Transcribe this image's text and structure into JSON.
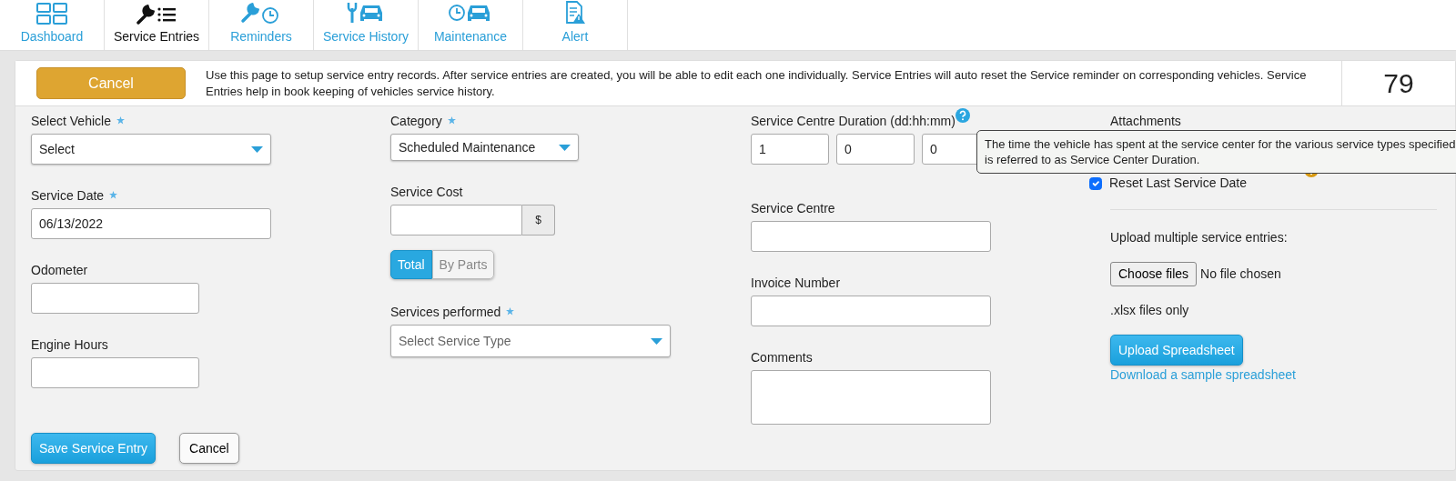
{
  "nav_tabs": [
    {
      "label": "Dashboard",
      "selected": false
    },
    {
      "label": "Service Entries",
      "selected": true
    },
    {
      "label": "Reminders",
      "selected": false
    },
    {
      "label": "Service History",
      "selected": false
    },
    {
      "label": "Maintenance",
      "selected": false
    },
    {
      "label": "Alert",
      "selected": false
    }
  ],
  "header": {
    "cancel_button": "Cancel",
    "info": "Use this page to setup service entry records. After service entries are created, you will be able to edit each one individually. Service Entries will auto reset the Service reminder on corresponding vehicles. Service Entries help in book keeping of vehicles service history.",
    "count": "79"
  },
  "columns": [
    {
      "fields": [
        {
          "kind": "select",
          "label": "Select Vehicle",
          "required": true,
          "value": "Select"
        },
        {
          "kind": "input",
          "label": "Service Date",
          "required": true,
          "value": "06/13/2022"
        },
        {
          "kind": "input",
          "label": "Odometer",
          "required": false
        },
        {
          "kind": "input",
          "label": "Engine Hours",
          "required": false
        }
      ]
    },
    {
      "fields": [
        {
          "kind": "select",
          "label": "Category",
          "required": true,
          "value": "Scheduled Maintenance"
        },
        {
          "kind": "money",
          "label": "Service Cost",
          "required": false,
          "addon": "$"
        },
        {
          "kind": "toggle",
          "options": [
            {
              "label": "Total",
              "selected": true
            },
            {
              "label": "By Parts",
              "selected": false
            }
          ]
        },
        {
          "kind": "select",
          "label": "Services performed",
          "required": true,
          "placeholder": "Select Service Type"
        }
      ]
    },
    {
      "fields": [
        {
          "kind": "duration",
          "label": "Service Centre Duration (dd:hh:mm)",
          "values": [
            "1",
            "0",
            "0"
          ],
          "tooltip": "The time the vehicle has spent at the service center for the various service types specified is referred to as Service Center Duration."
        },
        {
          "kind": "input",
          "label": "Service Centre",
          "required": false
        },
        {
          "kind": "input",
          "label": "Invoice Number",
          "required": false
        },
        {
          "kind": "textarea",
          "label": "Comments",
          "required": false
        }
      ]
    },
    {
      "fields": [
        {
          "kind": "attach",
          "label": "Attachments"
        },
        {
          "kind": "checkbox",
          "label": "Reset Last Service Date",
          "checked": true
        },
        {
          "kind": "upload",
          "label": "Upload multiple service entries:",
          "file_button": "Choose files",
          "file_status": "No file chosen",
          "hint": ".xlsx files only",
          "button": "Upload Spreadsheet",
          "link": "Download a sample spreadsheet"
        }
      ]
    }
  ],
  "footer": {
    "save_button": "Save Service Entry",
    "cancel_button": "Cancel"
  }
}
